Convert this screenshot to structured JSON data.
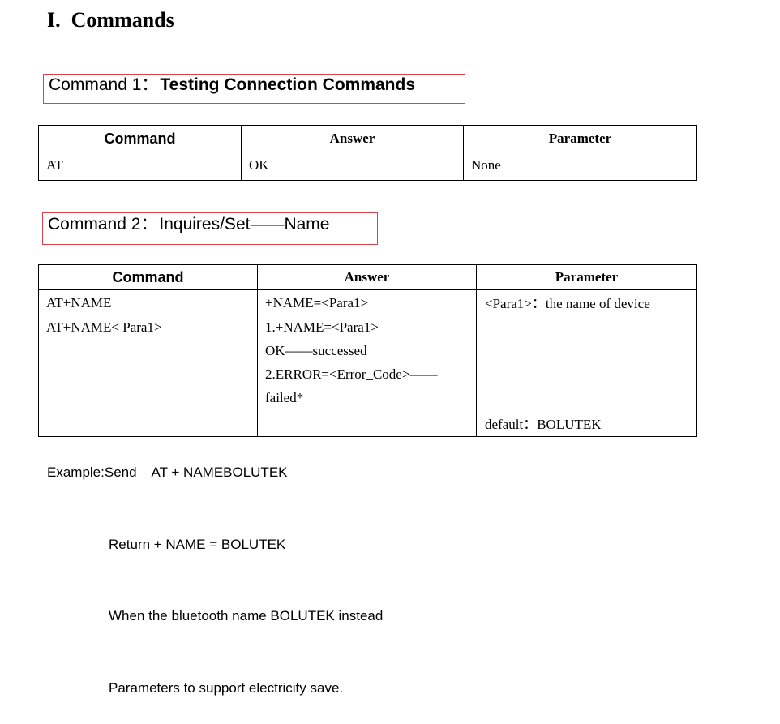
{
  "section_title": "I.  Commands",
  "command1": {
    "number": "Command 1",
    "separator": "：",
    "title": "Testing Connection Commands"
  },
  "table1": {
    "headers": [
      "Command",
      "Answer",
      "Parameter"
    ],
    "rows": [
      [
        "AT",
        "OK",
        "None"
      ]
    ]
  },
  "command2": {
    "number": "Command 2",
    "separator": "：",
    "title": "Inquires/Set——Name"
  },
  "table2": {
    "headers": [
      "Command",
      "Answer",
      "Parameter"
    ],
    "rows": [
      {
        "command": "AT+NAME",
        "answer": [
          "+NAME=<Para1>"
        ]
      },
      {
        "command": "AT+NAME< Para1>",
        "answer": [
          "1.+NAME=<Para1>",
          "OK——successed",
          "2.ERROR=<Error_Code>——",
          "failed*"
        ]
      }
    ],
    "parameter_top": "<Para1>：the name of device",
    "parameter_bottom": "default：BOLUTEK"
  },
  "example": {
    "line1": "Example:Send    AT + NAMEBOLUTEK",
    "line2": "Return + NAME = BOLUTEK",
    "line3": "When the bluetooth name BOLUTEK instead",
    "line4": "Parameters to support electricity save."
  }
}
